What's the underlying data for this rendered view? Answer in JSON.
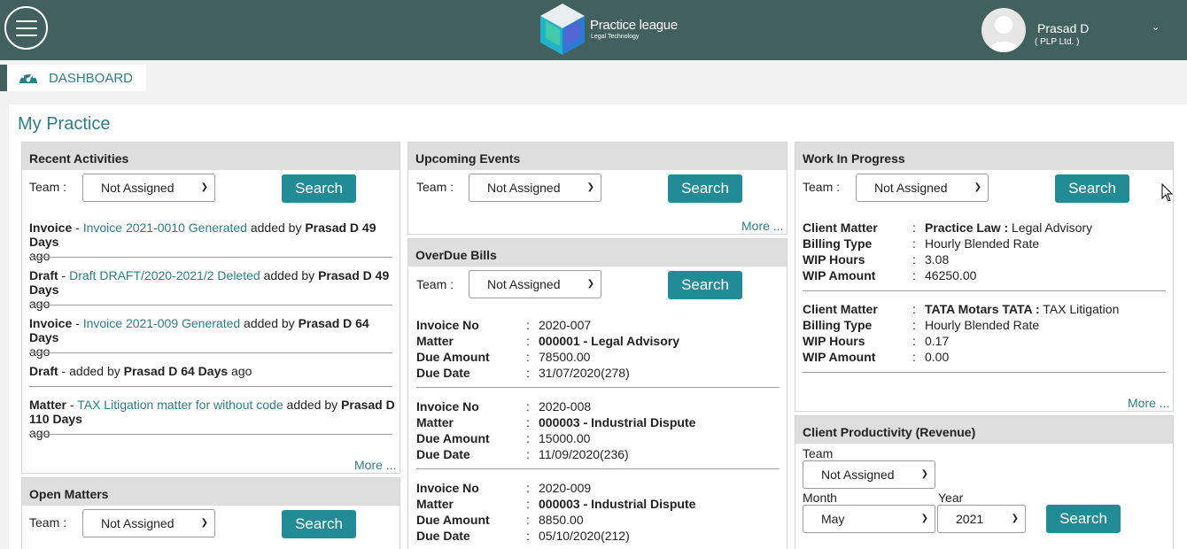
{
  "header": {
    "logo_title": "Practice league",
    "logo_subtitle": "Legal Technology",
    "user_name": "Prasad D",
    "user_org": "( PLP Ltd. )",
    "colors": {
      "bar": "#42605e",
      "accent": "#238b95",
      "link": "#2e7d86"
    }
  },
  "nav": {
    "dashboard_label": "DASHBOARD"
  },
  "page": {
    "title": "My Practice"
  },
  "recent_activities": {
    "title": "Recent Activities",
    "team_label": "Team :",
    "team_value": "Not Assigned",
    "search_label": "Search",
    "items": [
      {
        "type": "Invoice",
        "sep": " - ",
        "link": "Invoice 2021-0010 Generated",
        "added_by": " added by ",
        "who": "Prasad D 49 Days",
        "ago": "ago"
      },
      {
        "type": "Draft",
        "sep": " - ",
        "link": "Draft DRAFT/2020-2021/2 Deleted",
        "added_by": " added by ",
        "who": "Prasad D 49 Days",
        "ago": "ago"
      },
      {
        "type": "Invoice",
        "sep": " - ",
        "link": "Invoice 2021-009 Generated",
        "added_by": " added by ",
        "who": "Prasad D 64 Days",
        "ago": "ago"
      },
      {
        "type": "Draft",
        "sep": " - ",
        "link": "",
        "added_by": "added by ",
        "who": "Prasad D 64 Days",
        "ago": " ago"
      },
      {
        "type": "Matter",
        "sep": " - ",
        "link": "TAX Litigation matter for without code",
        "added_by": " added by ",
        "who": "Prasad D 110 Days",
        "ago": "ago"
      }
    ],
    "more_label": "More ..."
  },
  "open_matters": {
    "title": "Open Matters",
    "team_label": "Team :",
    "team_value": "Not Assigned",
    "search_label": "Search"
  },
  "upcoming_events": {
    "title": "Upcoming Events",
    "team_label": "Team :",
    "team_value": "Not Assigned",
    "search_label": "Search",
    "more_label": "More ..."
  },
  "overdue_bills": {
    "title": "OverDue Bills",
    "team_label": "Team :",
    "team_value": "Not Assigned",
    "search_label": "Search",
    "field_labels": [
      "Invoice No",
      "Matter",
      "Due Amount",
      "Due Date"
    ],
    "colon": ":",
    "bills": [
      {
        "invoice_no": "2020-007",
        "matter": "000001 - Legal Advisory",
        "due_amount": "78500.00",
        "due_date": "31/07/2020(278)"
      },
      {
        "invoice_no": "2020-008",
        "matter": "000003 - Industrial Dispute",
        "due_amount": "15000.00",
        "due_date": "11/09/2020(236)"
      },
      {
        "invoice_no": "2020-009",
        "matter": "000003 - Industrial Dispute",
        "due_amount": "8850.00",
        "due_date": "05/10/2020(212)"
      }
    ]
  },
  "work_in_progress": {
    "title": "Work In Progress",
    "team_label": "Team :",
    "team_value": "Not Assigned",
    "search_label": "Search",
    "field_labels": [
      "Client Matter",
      "Billing Type",
      "WIP Hours",
      "WIP Amount"
    ],
    "colon": ":",
    "entries": [
      {
        "client": "Practice Law :",
        "matter": " Legal Advisory",
        "billing_type": "Hourly Blended Rate",
        "wip_hours": "3.08",
        "wip_amount": "46250.00"
      },
      {
        "client": "TATA Motars TATA :",
        "matter": " TAX Litigation",
        "billing_type": "Hourly Blended Rate",
        "wip_hours": "0.17",
        "wip_amount": "0.00"
      }
    ],
    "more_label": "More ..."
  },
  "client_productivity": {
    "title": "Client Productivity (Revenue)",
    "team_label": "Team",
    "team_value": "Not Assigned",
    "month_label": "Month",
    "month_value": "May",
    "year_label": "Year",
    "year_value": "2021",
    "search_label": "Search"
  }
}
